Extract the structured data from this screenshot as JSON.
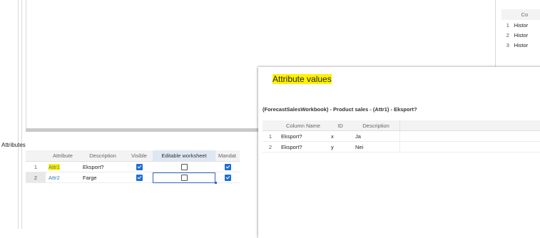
{
  "attributes_panel": {
    "title": "Attributes",
    "columns": [
      "Attribute",
      "Description",
      "Visible",
      "Editable worksheet",
      "Mandat"
    ],
    "rows": [
      {
        "num": "1",
        "attribute": "Attr1",
        "description": "Eksport?",
        "visible": true,
        "editable": false,
        "mandatory": true
      },
      {
        "num": "2",
        "attribute": "Attr2",
        "description": "Farge",
        "visible": true,
        "editable": false,
        "mandatory": true
      }
    ]
  },
  "mini_table": {
    "header": "Co",
    "rows": [
      {
        "num": "1",
        "value": "Histor"
      },
      {
        "num": "2",
        "value": "Histor"
      },
      {
        "num": "3",
        "value": "Histor"
      }
    ]
  },
  "dialog": {
    "title": "Attribute values",
    "subtitle": "(ForecastSalesWorkbook) - Product sales - (Attr1) - Eksport?",
    "columns": [
      "Column Name",
      "ID",
      "Description"
    ],
    "rows": [
      {
        "num": "1",
        "column_name": "Eksport?",
        "id": "x",
        "description": "Ja"
      },
      {
        "num": "2",
        "column_name": "Eksport?",
        "id": "y",
        "description": "Nei"
      }
    ]
  },
  "colors": {
    "highlight": "#fff200",
    "checkbox": "#1f6fd1",
    "link": "#3a78b8",
    "focus": "#2f64c9"
  }
}
